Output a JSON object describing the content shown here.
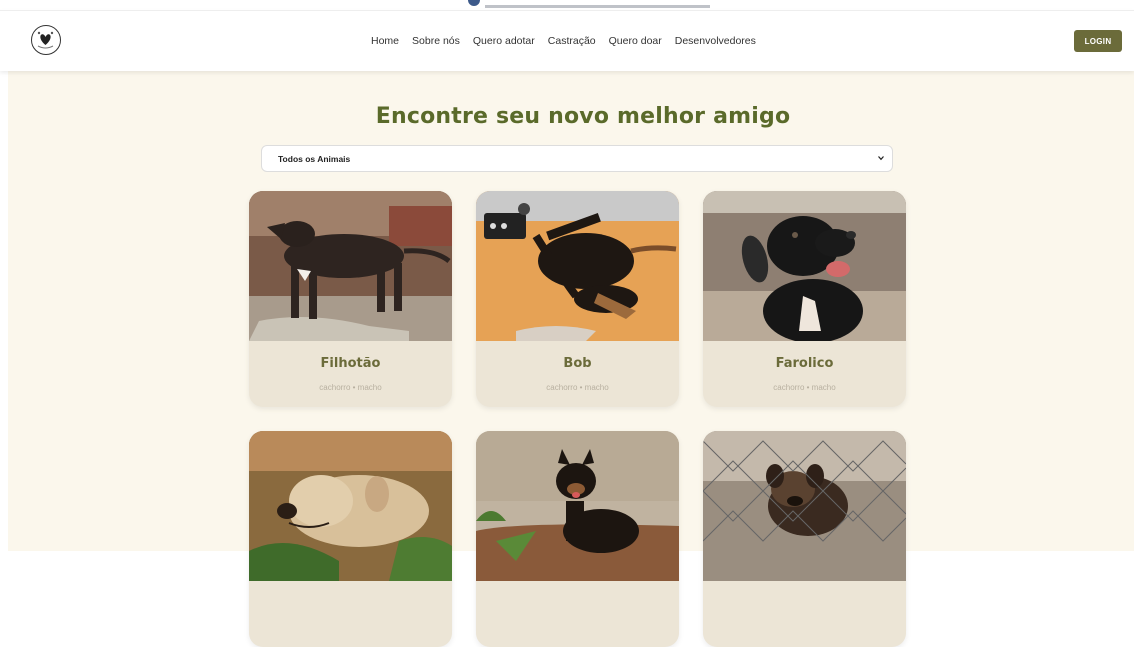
{
  "nav": {
    "items": [
      "Home",
      "Sobre nós",
      "Quero adotar",
      "Castração",
      "Quero doar",
      "Desenvolvedores"
    ],
    "login_label": "LOGIN",
    "logo_icon": "heart-paw-logo-icon"
  },
  "hero": {
    "title": "Encontre seu novo melhor amigo"
  },
  "filter": {
    "selected": "Todos os Animais"
  },
  "animals": [
    {
      "name": "Filhotão",
      "species": "cachorro",
      "sex": "macho",
      "meta": "cachorro • macho"
    },
    {
      "name": "Bob",
      "species": "cachorro",
      "sex": "macho",
      "meta": "cachorro • macho"
    },
    {
      "name": "Farolico",
      "species": "cachorro",
      "sex": "macho",
      "meta": "cachorro • macho"
    },
    {
      "name": "",
      "species": "cachorro",
      "sex": "",
      "meta": ""
    },
    {
      "name": "",
      "species": "cachorro",
      "sex": "",
      "meta": ""
    },
    {
      "name": "",
      "species": "cachorro",
      "sex": "",
      "meta": ""
    }
  ],
  "colors": {
    "accent": "#6b6b3a",
    "title": "#5a6a2a",
    "background": "#fbf7ec",
    "card": "#ece5d6"
  }
}
